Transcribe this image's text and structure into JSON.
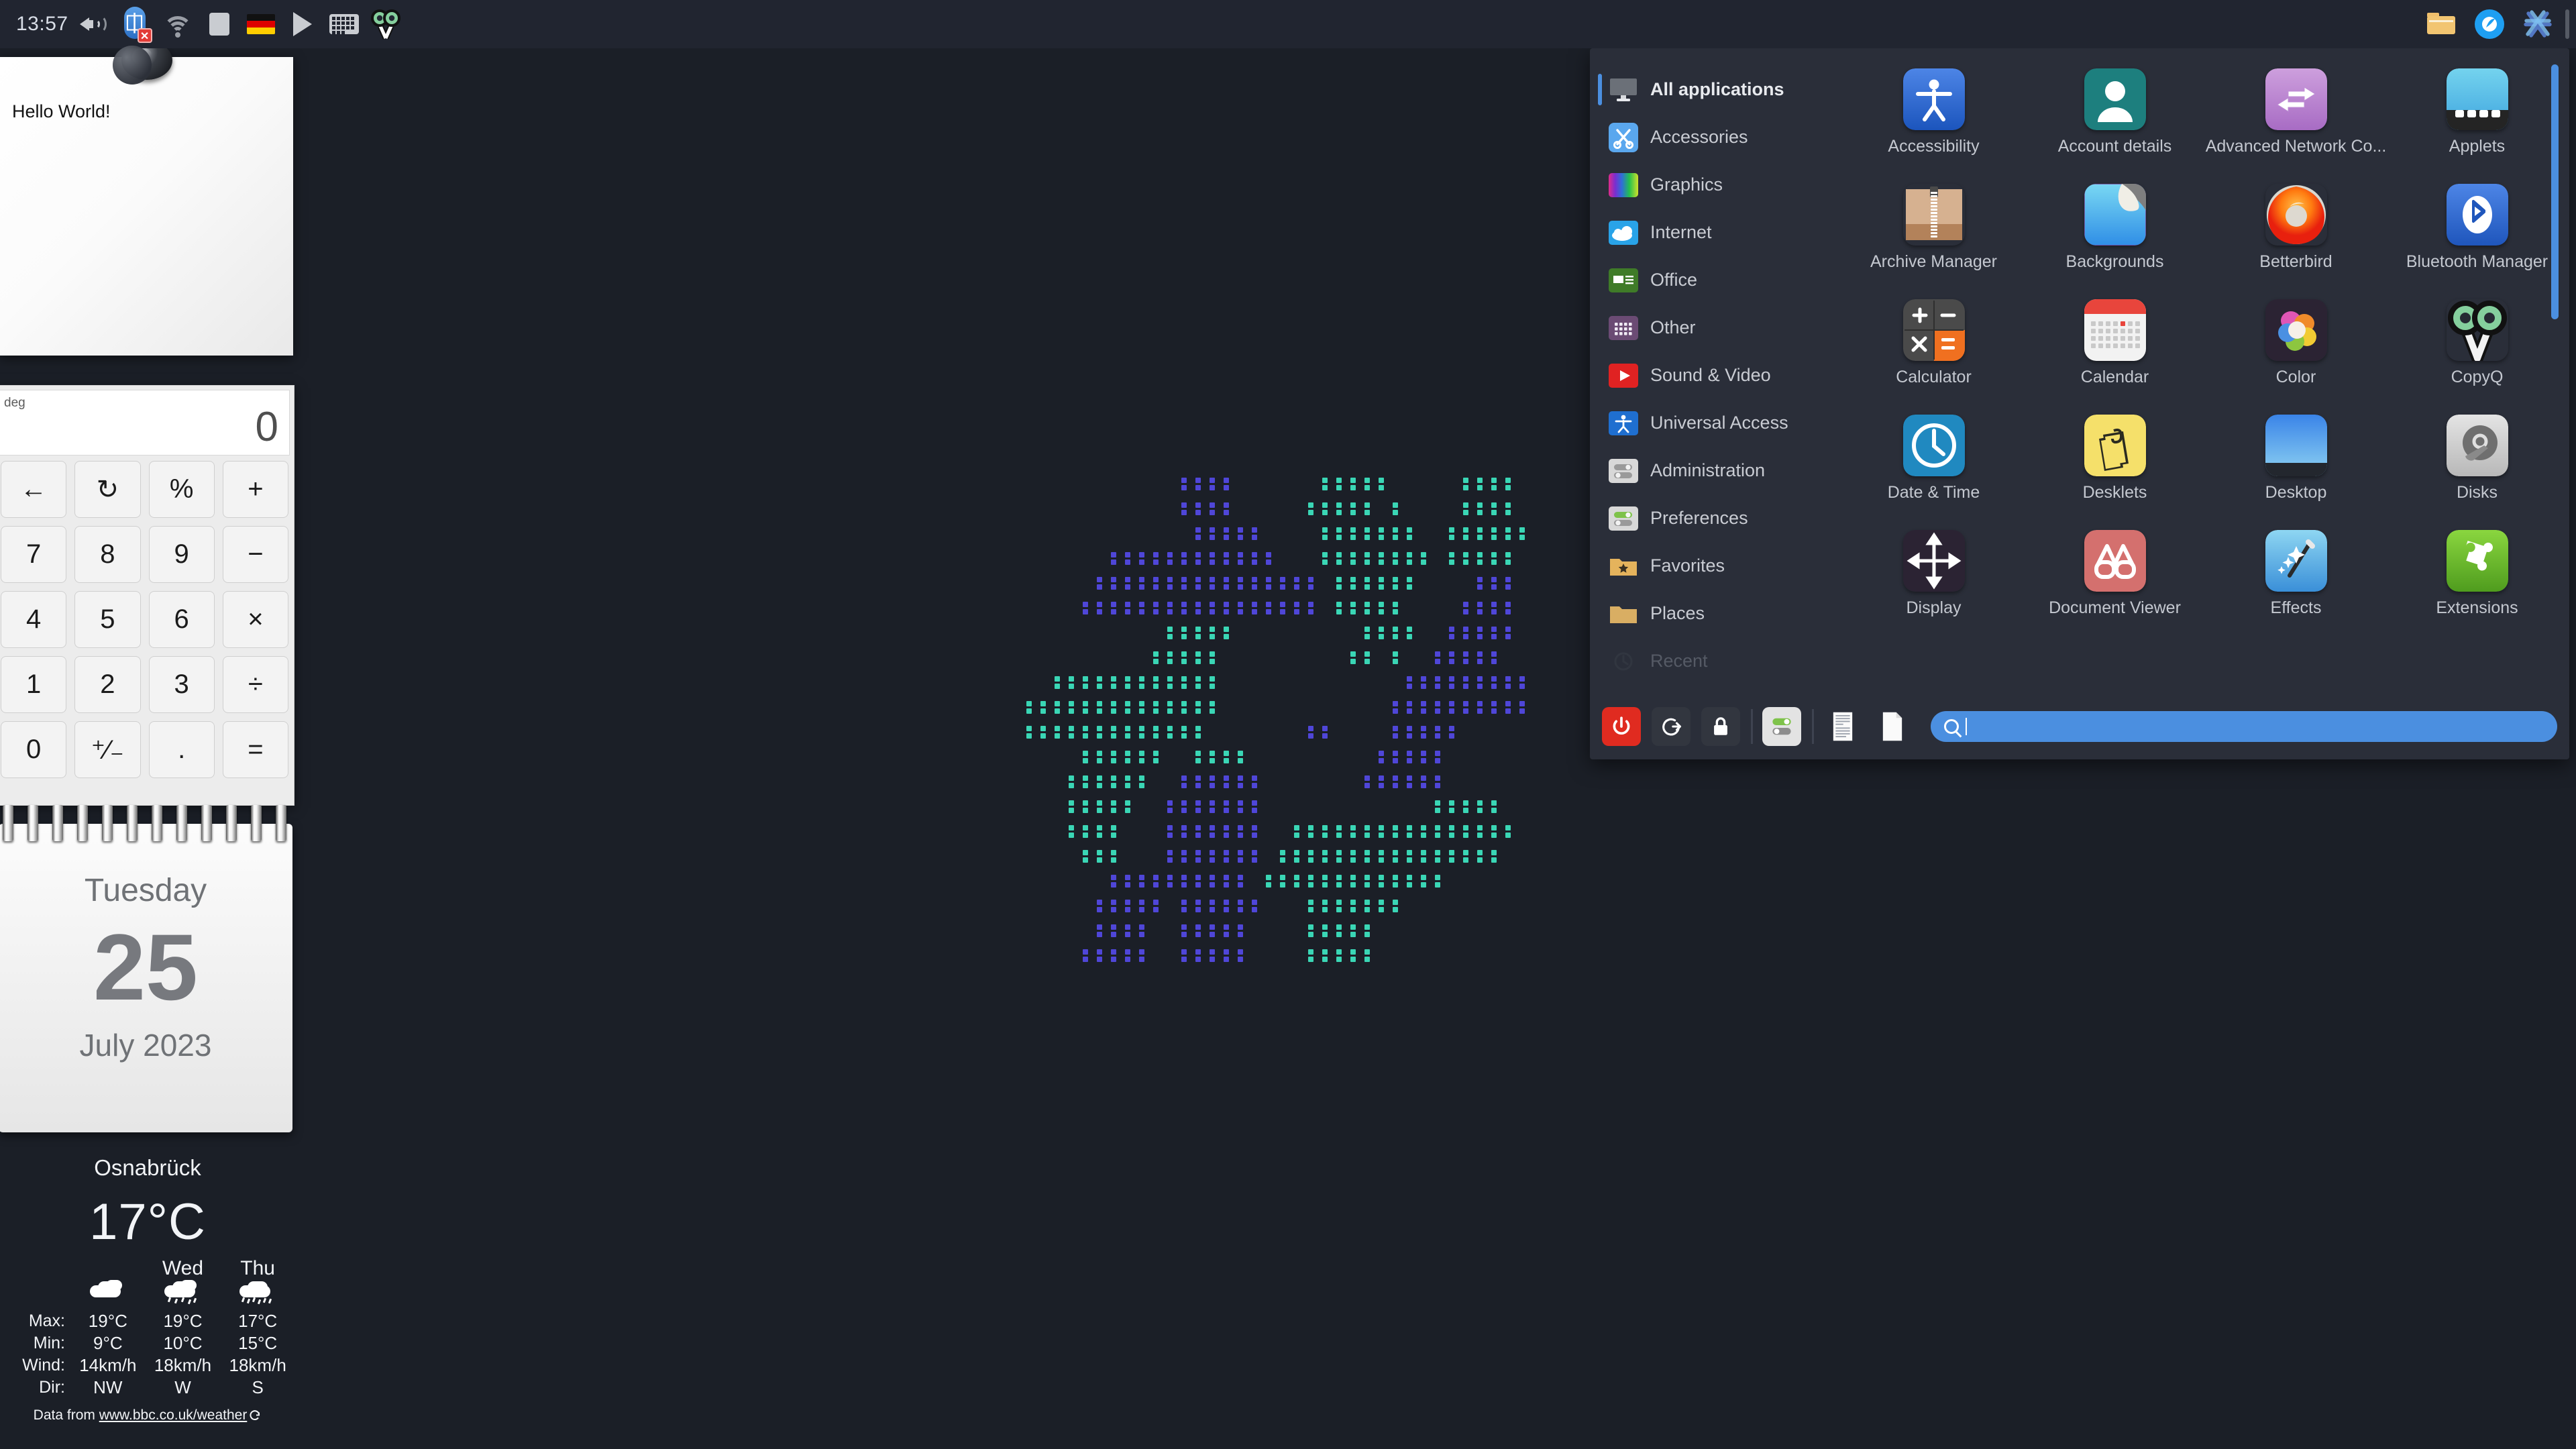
{
  "panel": {
    "clock": "13:57",
    "left_items": [
      {
        "name": "volume-icon",
        "label": "Volume"
      },
      {
        "name": "bluetooth-icon",
        "label": "Bluetooth disabled"
      },
      {
        "name": "wifi-icon",
        "label": "Network"
      },
      {
        "name": "blank-applet-icon",
        "label": "Applet"
      },
      {
        "name": "german-flag-icon",
        "label": "Keyboard layout: German"
      },
      {
        "name": "media-play-icon",
        "label": "Play"
      },
      {
        "name": "onscreen-keyboard-icon",
        "label": "On-screen keyboard"
      },
      {
        "name": "copyq-icon",
        "label": "CopyQ"
      }
    ],
    "right_items": [
      {
        "name": "file-manager-icon",
        "label": "Files"
      },
      {
        "name": "web-browser-icon",
        "label": "Browser"
      },
      {
        "name": "nixos-logo-icon",
        "label": "NixOS"
      },
      {
        "name": "panel-separator",
        "label": "Separator"
      }
    ]
  },
  "sticky_note": {
    "text": "Hello World!"
  },
  "calculator": {
    "mode": "deg",
    "display": "0",
    "keys": [
      "←",
      "↻",
      "%",
      "+",
      "7",
      "8",
      "9",
      "−",
      "4",
      "5",
      "6",
      "×",
      "1",
      "2",
      "3",
      "÷",
      "0",
      "⁺⁄₋",
      ".",
      "="
    ]
  },
  "calendar": {
    "dayname": "Tuesday",
    "daynum": "25",
    "monthyear": "July 2023"
  },
  "weather": {
    "city": "Osnabrück",
    "current_temp": "17°C",
    "day_headers": [
      "",
      "Wed",
      "Thu"
    ],
    "rows": [
      {
        "label": "Max:",
        "values": [
          "19°C",
          "19°C",
          "17°C"
        ]
      },
      {
        "label": "Min:",
        "values": [
          "9°C",
          "10°C",
          "15°C"
        ]
      },
      {
        "label": "Wind:",
        "values": [
          "14km/h",
          "18km/h",
          "18km/h"
        ]
      },
      {
        "label": "Dir:",
        "values": [
          "NW",
          "W",
          "S"
        ]
      }
    ],
    "conditions": [
      "partly-cloudy",
      "light-rain",
      "rain"
    ],
    "source_prefix": "Data from ",
    "source_link": "www.bbc.co.uk/weather",
    "refresh_icon": "refresh-icon"
  },
  "menu": {
    "categories": [
      {
        "label": "All applications",
        "icon": "monitor-icon",
        "color": "#6b7078",
        "selected": true,
        "dim": false
      },
      {
        "label": "Accessories",
        "icon": "scissors-icon",
        "color": "#5aa7ee",
        "selected": false,
        "dim": false
      },
      {
        "label": "Graphics",
        "icon": "gradient-icon",
        "color": "#8a3fbf",
        "selected": false,
        "dim": false
      },
      {
        "label": "Internet",
        "icon": "cloud-icon",
        "color": "#29a3e8",
        "selected": false,
        "dim": false
      },
      {
        "label": "Office",
        "icon": "document-green-icon",
        "color": "#3f7b28",
        "selected": false,
        "dim": false
      },
      {
        "label": "Other",
        "icon": "grid-dots-icon",
        "color": "#6b4b74",
        "selected": false,
        "dim": false
      },
      {
        "label": "Sound & Video",
        "icon": "play-red-icon",
        "color": "#e02222",
        "selected": false,
        "dim": false
      },
      {
        "label": "Universal Access",
        "icon": "accessibility-icon",
        "color": "#1f6fd0",
        "selected": false,
        "dim": false
      },
      {
        "label": "Administration",
        "icon": "toggles-gray-icon",
        "color": "#d6d6d6",
        "selected": false,
        "dim": false
      },
      {
        "label": "Preferences",
        "icon": "toggles-green-icon",
        "color": "#d6d6d6",
        "selected": false,
        "dim": false
      },
      {
        "label": "Favorites",
        "icon": "folder-star-icon",
        "color": "#e5b35c",
        "selected": false,
        "dim": false
      },
      {
        "label": "Places",
        "icon": "folder-icon",
        "color": "#d9ae63",
        "selected": false,
        "dim": false
      },
      {
        "label": "Recent",
        "icon": "clock-icon",
        "color": "#3a3e49",
        "selected": false,
        "dim": true
      }
    ],
    "apps": [
      {
        "label": "Accessibility",
        "icon": "accessibility-app-icon",
        "color": "#2f6fd8",
        "faded": false
      },
      {
        "label": "Account details",
        "icon": "user-avatar-icon",
        "color": "#1d7f7e",
        "faded": false
      },
      {
        "label": "Advanced Network Co...",
        "icon": "network-arrows-icon",
        "color": "#bc84d3",
        "faded": false
      },
      {
        "label": "Applets",
        "icon": "applets-icon",
        "color": "#52c1e8",
        "faded": false
      },
      {
        "label": "Archive Manager",
        "icon": "archive-zip-icon",
        "color": "#cfa684",
        "faded": false
      },
      {
        "label": "Backgrounds",
        "icon": "backgrounds-peel-icon",
        "color": "#3ba7ef",
        "faded": false
      },
      {
        "label": "Betterbird",
        "icon": "betterbird-icon",
        "color": "#ef4b17",
        "faded": false
      },
      {
        "label": "Bluetooth Manager",
        "icon": "bluetooth-app-icon",
        "color": "#2b63c8",
        "faded": false
      },
      {
        "label": "Calculator",
        "icon": "calculator-icon",
        "color": "#4a4a4a",
        "faded": false
      },
      {
        "label": "Calendar",
        "icon": "calendar-app-icon",
        "color": "#e8453c",
        "faded": false
      },
      {
        "label": "Color",
        "icon": "color-palette-icon",
        "color": "#2b2333",
        "faded": false
      },
      {
        "label": "CopyQ",
        "icon": "copyq-app-icon",
        "color": "#85cf9d",
        "faded": false
      },
      {
        "label": "Date & Time",
        "icon": "clock-app-icon",
        "color": "#2089c0",
        "faded": false
      },
      {
        "label": "Desklets",
        "icon": "desklets-notes-icon",
        "color": "#f5e06a",
        "faded": false
      },
      {
        "label": "Desktop",
        "icon": "desktop-icon",
        "color": "#3f93e8",
        "faded": false
      },
      {
        "label": "Disks",
        "icon": "disks-icon",
        "color": "#c9c9c9",
        "faded": false
      },
      {
        "label": "Display",
        "icon": "display-arrows-icon",
        "color": "#2b2333",
        "faded": false
      },
      {
        "label": "Document Viewer",
        "icon": "glasses-icon",
        "color": "#d4706e",
        "faded": false
      },
      {
        "label": "Effects",
        "icon": "magic-wand-icon",
        "color": "#5cb8e8",
        "faded": false
      },
      {
        "label": "Extensions",
        "icon": "puzzle-icon",
        "color": "#72c235",
        "faded": false
      }
    ],
    "system_buttons": [
      {
        "name": "power-off-button",
        "icon": "power-icon",
        "color": "#e02b20"
      },
      {
        "name": "logout-button",
        "icon": "logout-icon",
        "color": "#32363f"
      },
      {
        "name": "lock-button",
        "icon": "lock-icon",
        "color": "#32363f"
      },
      {
        "name": "settings-button",
        "icon": "toggles-icon",
        "color": "#e3e3e3"
      },
      {
        "name": "text-file-button",
        "icon": "text-file-icon",
        "color": "#f4f4f4"
      },
      {
        "name": "blank-file-button",
        "icon": "blank-file-icon",
        "color": "#f4f4f4"
      }
    ],
    "search": {
      "value": "",
      "placeholder": "",
      "icon": "search-icon"
    },
    "accent_color": "#4b8fe0",
    "background_color": "#2a2e39"
  },
  "desktop": {
    "background_color": "#1b1f27",
    "logo": {
      "name": "dot-matrix-logo",
      "colors": [
        "#3ad6b5",
        "#4f46d8"
      ]
    }
  }
}
